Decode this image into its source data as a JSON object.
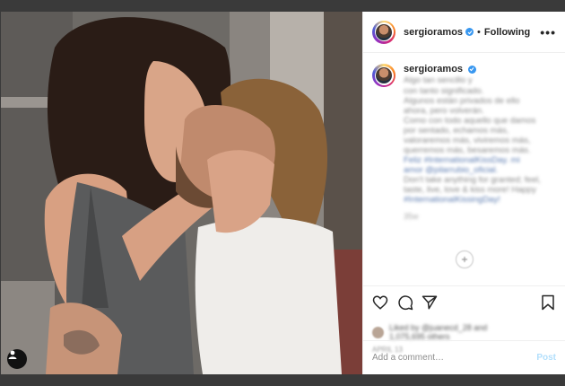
{
  "post": {
    "username": "sergioramos",
    "follow_status": "Following",
    "more_icon": "•••",
    "dot": "•"
  },
  "caption": {
    "username": "sergioramos",
    "lines": [
      "Algo tan sencillo y",
      "con tanto significado.",
      "Algunos están privados de ello",
      "ahora, pero volverán.",
      "Como con todo aquello que damos",
      "por sentado, echamos más,",
      "valoraremos más, viviremos más,",
      "querremos más, besaremos más.",
      "Feliz #InternationalKissDay. mi",
      "amor @pilarrubio_oficial.",
      "Don't take anything for granted; feel,",
      "taste, live, love & kiss more! Happy",
      "#InternationalKissingDay!"
    ],
    "time": "35w"
  },
  "likes": {
    "line1": "Liked by @juanecd_28 and",
    "line2": "1,075,695 others"
  },
  "date": "APRIL 13",
  "comment_box": {
    "placeholder": "Add a comment…",
    "post_label": "Post"
  },
  "icons": [
    "verified-badge-icon",
    "heart-icon",
    "comment-icon",
    "share-icon",
    "bookmark-icon",
    "user-tag-icon",
    "load-more-icon"
  ],
  "colors": {
    "accent": "#3897f0",
    "post_disabled": "#b2dffc",
    "text": "#262626"
  }
}
